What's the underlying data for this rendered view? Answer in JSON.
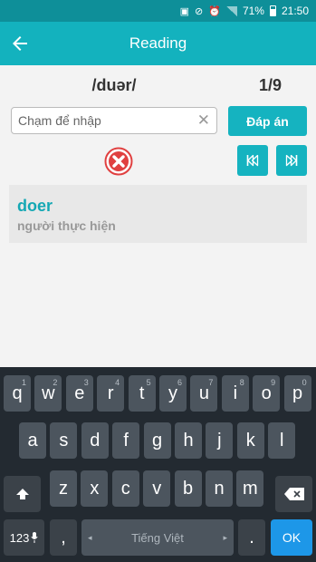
{
  "status_bar": {
    "battery": "71%",
    "time": "21:50"
  },
  "app_bar": {
    "title": "Reading"
  },
  "quiz": {
    "phonetic": "/duər/",
    "counter": "1/9",
    "input_placeholder": "Chạm để nhập",
    "input_value": "",
    "answer_button": "Đáp án"
  },
  "result": {
    "word": "doer",
    "meaning": "người thực hiện"
  },
  "colors": {
    "status_bar": "#0e8f99",
    "accent": "#13b2be",
    "wrong": "#e04040",
    "word": "#15a8b4"
  },
  "keyboard": {
    "row1": [
      {
        "key": "q",
        "sub": "1"
      },
      {
        "key": "w",
        "sub": "2"
      },
      {
        "key": "e",
        "sub": "3"
      },
      {
        "key": "r",
        "sub": "4"
      },
      {
        "key": "t",
        "sub": "5"
      },
      {
        "key": "y",
        "sub": "6"
      },
      {
        "key": "u",
        "sub": "7"
      },
      {
        "key": "i",
        "sub": "8"
      },
      {
        "key": "o",
        "sub": "9"
      },
      {
        "key": "p",
        "sub": "0"
      }
    ],
    "row2": [
      "a",
      "s",
      "d",
      "f",
      "g",
      "h",
      "j",
      "k",
      "l"
    ],
    "row3": [
      "z",
      "x",
      "c",
      "v",
      "b",
      "n",
      "m"
    ],
    "num_key": "123",
    "comma": ",",
    "space_label": "Tiếng Việt",
    "period": ".",
    "ok": "OK",
    "icons": {
      "shift": "shift-icon",
      "backspace": "backspace-icon",
      "mic": "mic-icon"
    }
  }
}
